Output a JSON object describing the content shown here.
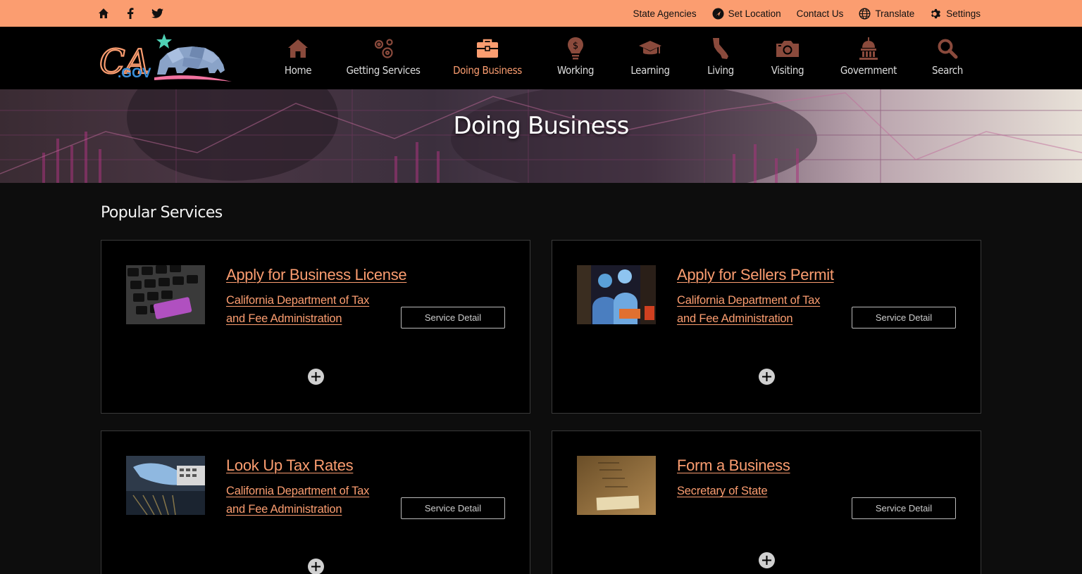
{
  "utility": {
    "left_icons": [
      "home-icon",
      "facebook-icon",
      "twitter-icon"
    ],
    "links": {
      "state_agencies": "State Agencies",
      "set_location": "Set Location",
      "contact_us": "Contact Us",
      "translate": "Translate",
      "settings": "Settings"
    }
  },
  "logo": {
    "ca": "CA",
    "gov": ".GOV"
  },
  "nav": {
    "items": [
      {
        "label": "Home",
        "icon": "home-icon"
      },
      {
        "label": "Getting Services",
        "icon": "gears-icon"
      },
      {
        "label": "Doing Business",
        "icon": "briefcase-icon",
        "active": true
      },
      {
        "label": "Working",
        "icon": "lightbulb-dollar-icon"
      },
      {
        "label": "Learning",
        "icon": "graduation-cap-icon"
      },
      {
        "label": "Living",
        "icon": "california-map-icon"
      },
      {
        "label": "Visiting",
        "icon": "camera-icon"
      },
      {
        "label": "Government",
        "icon": "capitol-dome-icon"
      },
      {
        "label": "Search",
        "icon": "search-icon"
      }
    ]
  },
  "hero": {
    "title": "Doing Business"
  },
  "section": {
    "title": "Popular Services"
  },
  "cards": [
    {
      "title": "Apply for Business License",
      "dept": "California Department of Tax and Fee Administration",
      "button": "Service Detail",
      "thumb": "keyboard-apply-key-image"
    },
    {
      "title": "Apply for Sellers Permit",
      "dept": "California Department of Tax and Fee Administration",
      "button": "Service Detail",
      "thumb": "shop-owners-image"
    },
    {
      "title": "Look Up Tax Rates",
      "dept": "California Department of Tax and Fee Administration",
      "button": "Service Detail",
      "thumb": "calculator-hand-image"
    },
    {
      "title": "Form a Business",
      "dept": "Secretary of State",
      "button": "Service Detail",
      "thumb": "register-now-image"
    }
  ],
  "colors": {
    "accent": "#fb9d70",
    "utility_bg": "#fb9d70",
    "nav_bg": "#000000",
    "page_bg": "#0d0d0d",
    "nav_icon": "#8a4a3c"
  }
}
